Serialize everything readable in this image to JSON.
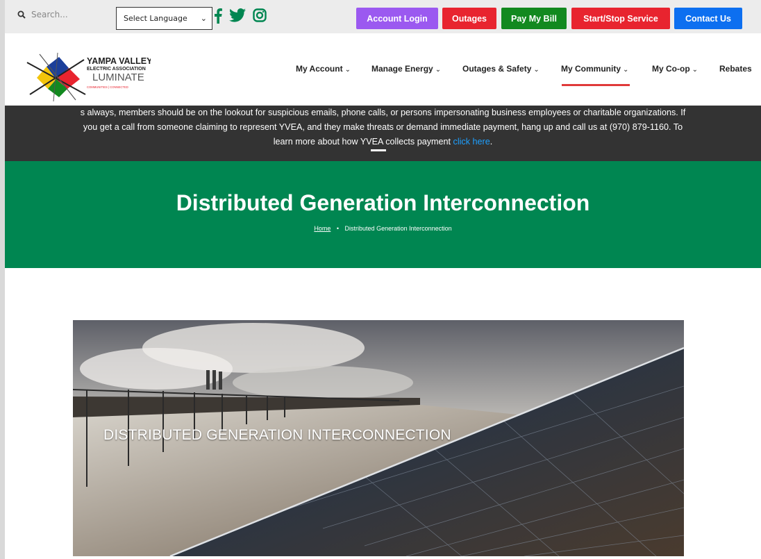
{
  "topbar": {
    "search_placeholder": "Search...",
    "language_label": "Select Language",
    "buttons": [
      {
        "label": "Account Login",
        "color": "#9b59f0"
      },
      {
        "label": "Outages",
        "color": "#e8242f"
      },
      {
        "label": "Pay My Bill",
        "color": "#12891f"
      },
      {
        "label": "Start/Stop Service",
        "color": "#e8242f"
      },
      {
        "label": "Contact Us",
        "color": "#0d6ff0"
      }
    ],
    "social_color": "#008651"
  },
  "logo": {
    "line1": "YAMPA VALLEY",
    "line2": "ELECTRIC ASSOCIATION",
    "line3": "LUMINATE",
    "tagline": "COMMUNITIES | CONNECTED"
  },
  "nav": {
    "items": [
      {
        "label": "My Account"
      },
      {
        "label": "Manage Energy"
      },
      {
        "label": "Outages & Safety"
      },
      {
        "label": "My Community"
      },
      {
        "label": "My Co-op"
      },
      {
        "label": "Rebates"
      }
    ],
    "active_color": "#e03a3a"
  },
  "alert": {
    "line1": "s always, members should be on the lookout for suspicious emails, phone calls, or persons impersonating business employees or charitable organizations. If",
    "line2": "you get a call from someone claiming to represent YVEA, and they make threats or demand immediate payment, hang up and call us at (970) 879-1160. To",
    "line3": "learn more about how YVEA collects payment ",
    "link": "click here",
    "line3_end": "."
  },
  "hero": {
    "title": "Distributed Generation Interconnection",
    "breadcrumb_home": "Home",
    "breadcrumb_separator": "•",
    "breadcrumb_current": "Distributed Generation Interconnection",
    "background": "#008651"
  },
  "banner": {
    "title": "DISTRIBUTED GENERATION INTERCONNECTION"
  }
}
